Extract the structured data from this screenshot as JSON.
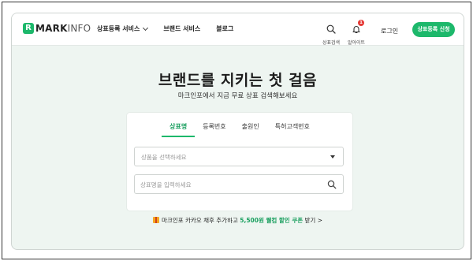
{
  "header": {
    "logo_mark": "R",
    "logo_bold": "MARK",
    "logo_light": "INFO",
    "nav": [
      {
        "label": "상표등록 서비스"
      },
      {
        "label": "브랜드 서비스"
      },
      {
        "label": "블로그"
      }
    ],
    "search_label": "상표검색",
    "alarm_label": "알아이트",
    "alarm_count": "1",
    "login_label": "로그인",
    "cta_label": "상표등록 신청"
  },
  "hero": {
    "title": "브랜드를 지키는 첫 걸음",
    "subtitle": "마크인포에서 지금 무료 상표 검색해보세요"
  },
  "search_panel": {
    "tabs": [
      {
        "label": "상표명",
        "active": true
      },
      {
        "label": "등록번호",
        "active": false
      },
      {
        "label": "출원인",
        "active": false
      },
      {
        "label": "특허고객번호",
        "active": false
      }
    ],
    "select_placeholder": "상품을 선택하세요",
    "input_placeholder": "상표명을 입력하세요",
    "input_value": ""
  },
  "promo": {
    "prefix": "마크인포 카카오 채후 추가하고 ",
    "highlight": "5,500원 웰컴 할인 쿠폰",
    "suffix": " 받기 >"
  },
  "colors": {
    "accent": "#1db86b",
    "hero_bg": "#eef5f1",
    "badge": "#e53935"
  }
}
